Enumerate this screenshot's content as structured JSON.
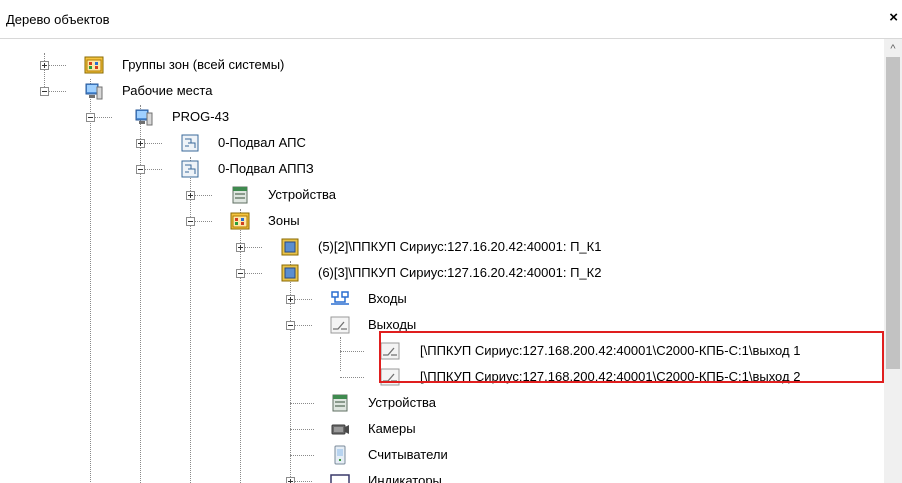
{
  "panel": {
    "title": "Дерево объектов",
    "close_label": "×"
  },
  "scroll": {
    "up_arrow": "^"
  },
  "tree": {
    "n1": "Группы зон (всей системы)",
    "n2": "Рабочие места",
    "n3": "PROG-43",
    "n4": "0-Подвал АПС",
    "n5": "0-Подвал АППЗ",
    "n6": "Устройства",
    "n7": "Зоны",
    "n8": "(5)[2]\\ППКУП Сириус:127.16.20.42:40001: П_К1",
    "n9": "(6)[3]\\ППКУП Сириус:127.16.20.42:40001: П_К2",
    "n10": "Входы",
    "n11": "Выходы",
    "n12": "[\\ППКУП Сириус:127.168.200.42:40001\\С2000-КПБ-С:1\\выход 1",
    "n13": "[\\ППКУП Сириус:127.168.200.42:40001\\С2000-КПБ-С:1\\выход 2",
    "n14": "Устройства",
    "n15": "Камеры",
    "n16": "Считыватели",
    "n17": "Индикаторы"
  },
  "icons": {
    "groups": "zone-group-icon",
    "workstation": "workstation-icon",
    "schematic": "floor-plan-icon",
    "devices": "devices-icon",
    "zones": "zones-icon",
    "zone": "zone-icon",
    "inputs": "inputs-icon",
    "outputs": "outputs-icon",
    "camera": "camera-icon",
    "reader": "reader-icon",
    "indicator": "indicator-icon"
  },
  "colors": {
    "highlight": "#e01e1e",
    "scroll_thumb": "#c2c2c2"
  }
}
